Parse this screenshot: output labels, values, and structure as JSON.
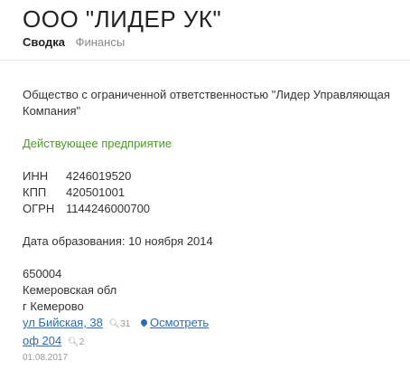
{
  "header": {
    "title": "ООО \"ЛИДЕР УК\"",
    "tabs": [
      {
        "label": "Сводка",
        "active": true
      },
      {
        "label": "Финансы",
        "active": false
      }
    ]
  },
  "company": {
    "full_name": "Общество с ограниченной ответственностью \"Лидер Управляющая Компания\"",
    "status": "Действующее предприятие",
    "codes": [
      {
        "label": "ИНН",
        "value": "4246019520"
      },
      {
        "label": "КПП",
        "value": "420501001"
      },
      {
        "label": "ОГРН",
        "value": "1144246000700"
      }
    ],
    "founded": "Дата образования: 10 ноября 2014"
  },
  "address": {
    "postcode": "650004",
    "region": "Кемеровская обл",
    "city": "г Кемерово",
    "street": "ул Бийская, 38",
    "street_count": "31",
    "map_label": "Осмотреть",
    "office": "оф 204",
    "office_count": "2",
    "date": "01.08.2017"
  },
  "colors": {
    "status": "#4e9a26",
    "link": "#2a6cb6",
    "muted": "#999999"
  }
}
